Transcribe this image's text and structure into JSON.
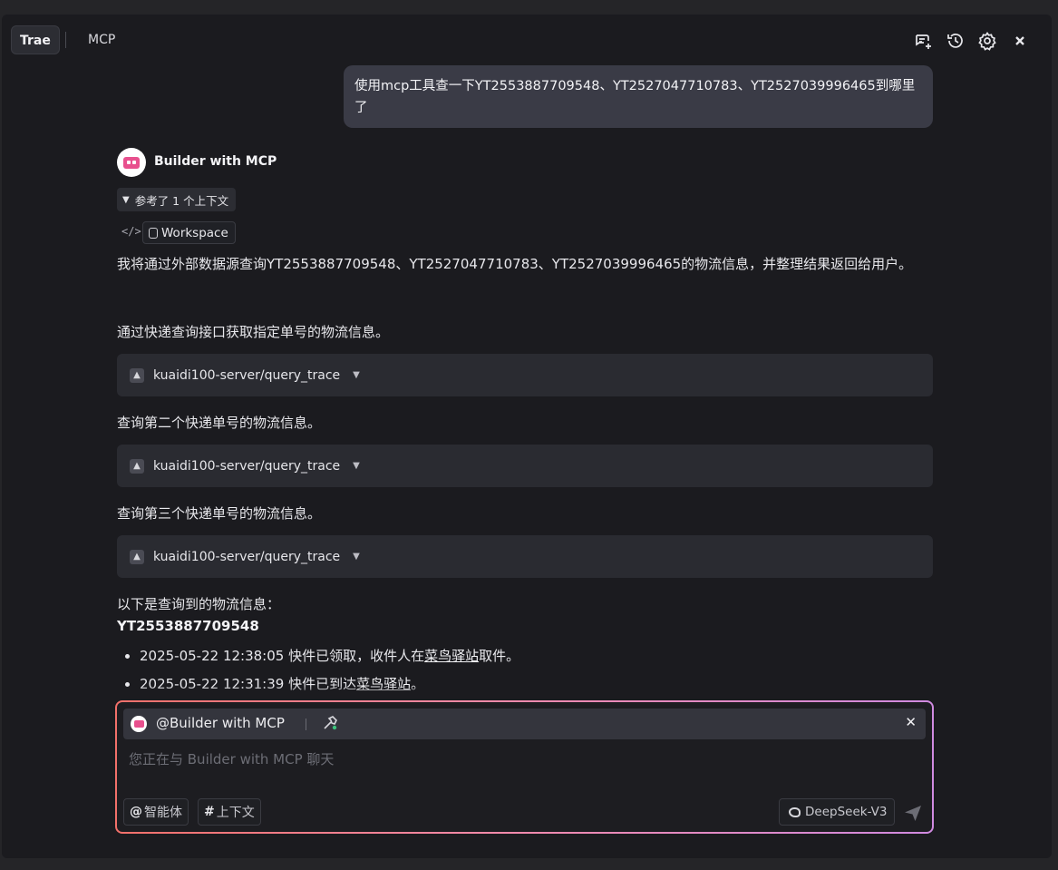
{
  "header": {
    "tab_trae": "Trae",
    "tab_mcp": "MCP",
    "icons": [
      "new-chat-icon",
      "history-icon",
      "settings-icon",
      "close-icon"
    ]
  },
  "conversation": {
    "user_message": "使用mcp工具查一下YT2553887709548、YT2527047710783、YT2527039996465到哪里了",
    "agent_name": "Builder with MCP",
    "context_toggle": "参考了 1 个上下文",
    "workspace_label": "Workspace",
    "intro": "我将通过外部数据源查询YT2553887709548、YT2527047710783、YT2527039996465的物流信息，并整理结果返回给用户。",
    "steps": [
      {
        "text": "通过快递查询接口获取指定单号的物流信息。",
        "tool": "kuaidi100-server/query_trace"
      },
      {
        "text": "查询第二个快递单号的物流信息。",
        "tool": "kuaidi100-server/query_trace"
      },
      {
        "text": "查询第三个快递单号的物流信息。",
        "tool": "kuaidi100-server/query_trace"
      }
    ],
    "results_intro": "以下是查询到的物流信息：",
    "result_tracking_no": "YT2553887709548",
    "result_items": [
      {
        "prefix": "2025-05-22 12:38:05 快件已领取，收件人在",
        "link": "菜鸟驿站",
        "suffix": "取件。"
      },
      {
        "prefix": "2025-05-22 12:31:39 快件已到达",
        "link": "菜鸟驿站",
        "suffix": "。"
      }
    ]
  },
  "composer": {
    "agent_mention": "@Builder with MCP",
    "placeholder": "您正在与 Builder with MCP 聊天",
    "agent_chip": "智能体",
    "context_chip": "上下文",
    "model": "DeepSeek-V3"
  },
  "colors": {
    "background": "#1b1b1f",
    "bubble": "#3a3b46",
    "card": "#2a2b31",
    "border_gradient_start": "#f2706a",
    "border_gradient_end": "#d08ae0",
    "avatar_accent": "#e8508e"
  }
}
